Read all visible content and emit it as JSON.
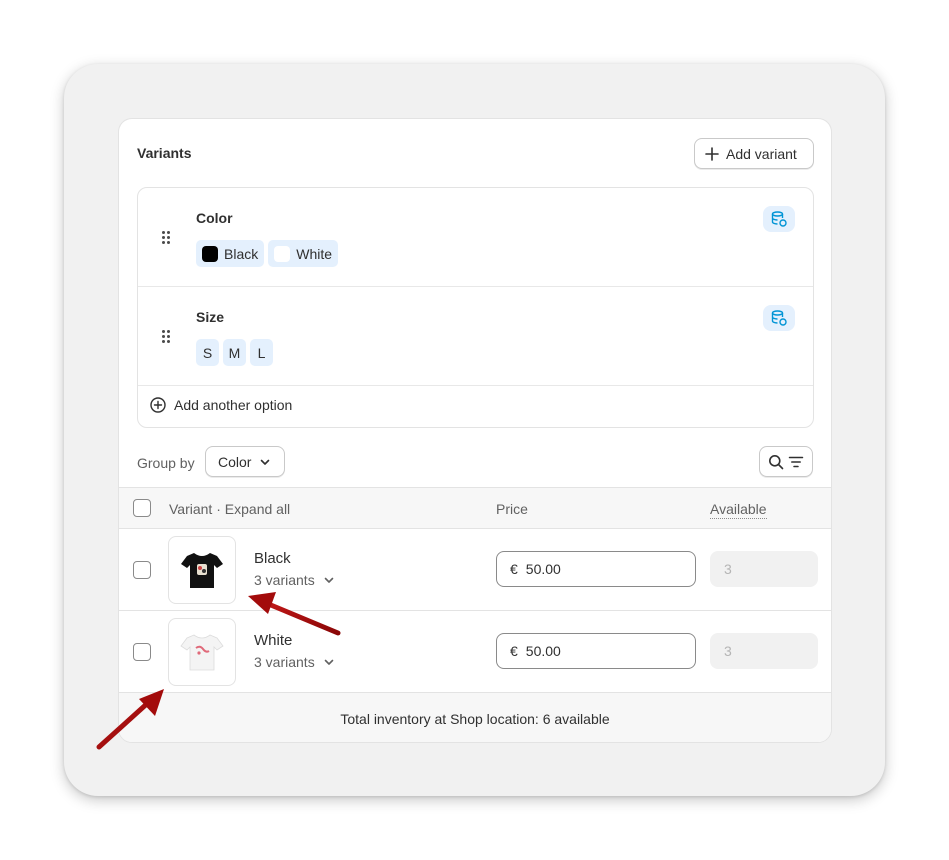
{
  "variants_card": {
    "title": "Variants",
    "add_variant_label": "Add variant",
    "options": [
      {
        "name": "Color",
        "values": [
          {
            "label": "Black",
            "swatch": "#000000"
          },
          {
            "label": "White",
            "swatch": "#ffffff"
          }
        ]
      },
      {
        "name": "Size",
        "values": [
          {
            "label": "S"
          },
          {
            "label": "M"
          },
          {
            "label": "L"
          }
        ]
      }
    ],
    "add_option_label": "Add another option",
    "group_by_label": "Group by",
    "group_by_value": "Color",
    "table": {
      "col_variant": "Variant",
      "separator": "·",
      "expand_all": "Expand all",
      "col_price": "Price",
      "col_available": "Available",
      "rows": [
        {
          "name": "Black",
          "count": "3 variants",
          "currency": "€",
          "price": "50.00",
          "available": "3",
          "tshirt_color": "#111111"
        },
        {
          "name": "White",
          "count": "3 variants",
          "currency": "€",
          "price": "50.00",
          "available": "3",
          "tshirt_color": "#f4f4f4"
        }
      ]
    },
    "footer_text": "Total inventory at Shop location: 6 available"
  },
  "colors": {
    "accent_chip": "#e4f0fd",
    "icon_blue": "#0094d5",
    "annotation_arrow": "#a30b0b"
  }
}
